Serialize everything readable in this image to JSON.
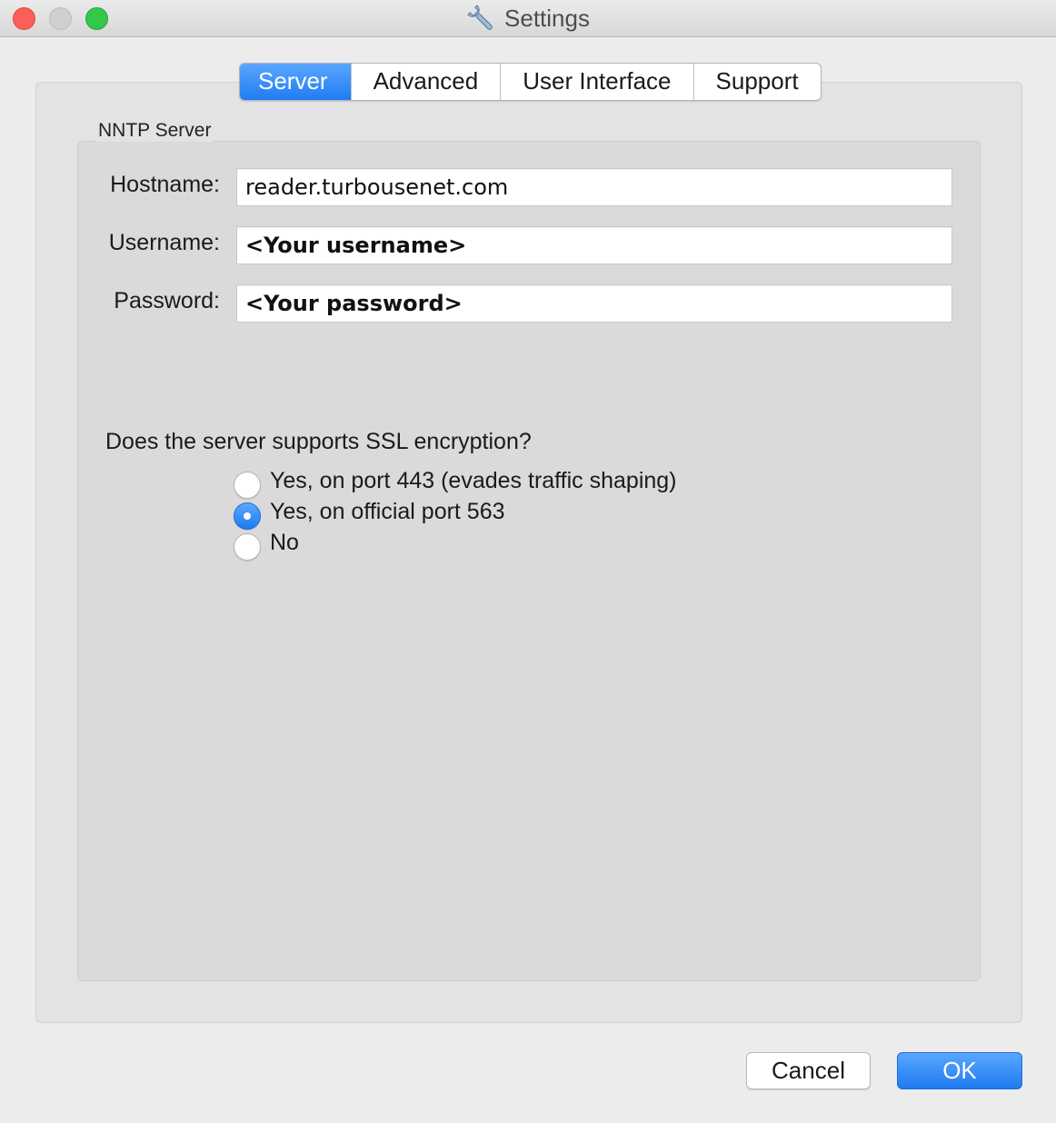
{
  "window": {
    "title": "Settings",
    "title_icon": "wrench-icon"
  },
  "tabs": [
    {
      "label": "Server",
      "active": true
    },
    {
      "label": "Advanced",
      "active": false
    },
    {
      "label": "User Interface",
      "active": false
    },
    {
      "label": "Support",
      "active": false
    }
  ],
  "nntp_server": {
    "group_title": "NNTP Server",
    "hostname_label": "Hostname:",
    "hostname_value": "reader.turbousenet.com",
    "username_label": "Username:",
    "username_value": "<Your username>",
    "password_label": "Password:",
    "password_value": "<Your password>",
    "ssl_question": "Does the server supports SSL encryption?",
    "ssl_options": [
      {
        "label": "Yes, on port 443 (evades traffic shaping)",
        "selected": false
      },
      {
        "label": "Yes, on official port 563",
        "selected": true
      },
      {
        "label": "No",
        "selected": false
      }
    ]
  },
  "buttons": {
    "cancel_label": "Cancel",
    "ok_label": "OK"
  },
  "colors": {
    "accent": "#1f7cf2",
    "close": "#fc5f57",
    "maximize": "#34c84a"
  }
}
